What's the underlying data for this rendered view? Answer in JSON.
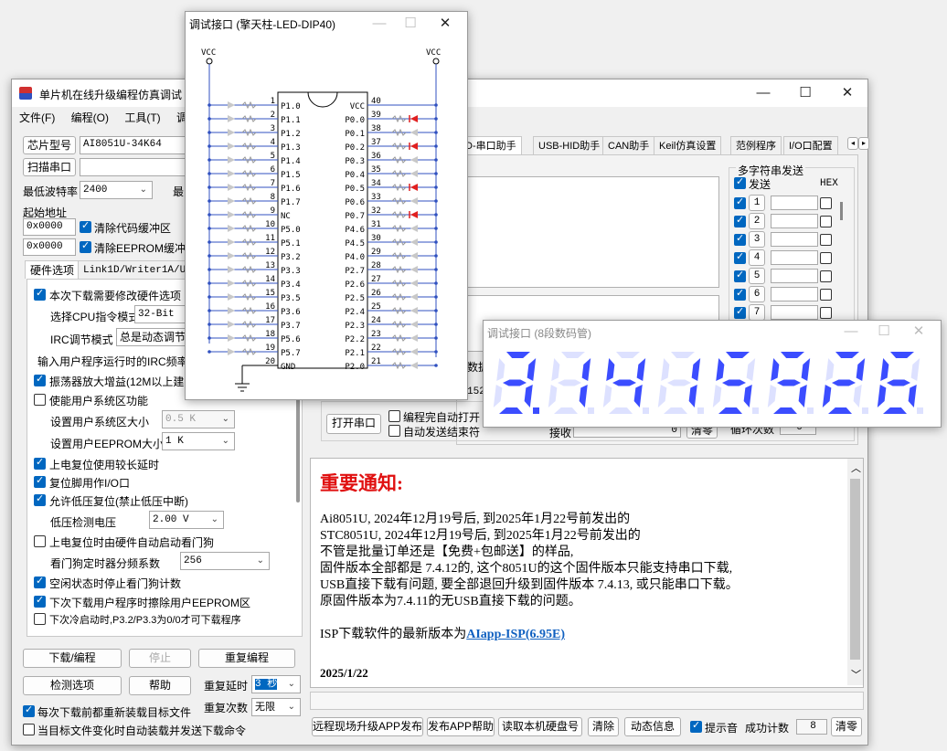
{
  "main": {
    "title": "单片机在线升级编程仿真调试",
    "menu": [
      "文件(F)",
      "编程(O)",
      "工具(T)",
      "调试"
    ],
    "chip_model_label": "芯片型号",
    "chip_model_value": "AI8051U-34K64",
    "scan_port_button": "扫描串口",
    "min_baud_label": "最低波特率",
    "min_baud_value": "2400",
    "max_baud_label": "最",
    "start_addr_label": "起始地址",
    "addr1": "0x0000",
    "clear_code_label": "清除代码缓冲区",
    "addr2": "0x0000",
    "clear_eeprom_label": "清除EEPROM缓冲区",
    "tabs": [
      "硬件选项",
      "Link1D/Writer1A/U8W"
    ],
    "options": {
      "modify_hw": "本次下载需要修改硬件选项",
      "cpu_mode_label": "选择CPU指令模式",
      "cpu_mode_value": "32-Bit",
      "irc_label": "IRC调节模式",
      "irc_value": "总是动态调节",
      "input_irc_label": "输入用户程序运行时的IRC频率",
      "osc_gain": "振荡器放大增益(12M以上建议",
      "user_sys_area": "使能用户系统区功能",
      "sys_area_size_label": "设置用户系统区大小",
      "sys_area_size_value": "0.5 K",
      "eeprom_size_label": "设置用户EEPROM大小",
      "eeprom_size_value": "1  K",
      "long_reset_delay": "上电复位使用较长延时",
      "reset_pin_io": "复位脚用作I/O口",
      "allow_lvr": "允许低压复位(禁止低压中断)",
      "lvd_label": "低压检测电压",
      "lvd_value": "2.00 V",
      "wdt_auto": "上电复位时由硬件自动启动看门狗",
      "wdt_div_label": "看门狗定时器分频系数",
      "wdt_div_value": "256",
      "idle_stop_wdt": "空闲状态时停止看门狗计数",
      "erase_eeprom": "下次下载用户程序时擦除用户EEPROM区",
      "cold_boot": "下次冷启动时,P3.2/P3.3为0/0才可下载程序"
    },
    "buttons": {
      "download": "下载/编程",
      "stop": "停止",
      "repeat": "重复编程",
      "check_options": "检测选项",
      "help": "帮助",
      "repeat_delay_label": "重复延时",
      "repeat_delay_value": "3 秒",
      "repeat_count_label": "重复次数",
      "repeat_count_value": "无限"
    },
    "reload_target": "每次下载前都重新装载目标文件",
    "auto_reload": "当目标文件变化时自动装载并发送下载命令",
    "right_tabs": [
      "D-串口助手",
      "USB-HID助手",
      "CAN助手",
      "Keil仿真设置",
      "范例程序",
      "I/O口配置"
    ],
    "multi_send": {
      "title": "多字符串发送",
      "send_label": "发送",
      "hex_label": "HEX",
      "rows": [
        "1",
        "2",
        "3",
        "4",
        "5",
        "6",
        "7"
      ]
    },
    "serial": {
      "data_label": "数据",
      "baud_partial": "152",
      "open_port": "打开串口",
      "auto_open": "编程完自动打开",
      "auto_send_end": "自动发送结束符",
      "recv_label": "接收",
      "recv_count": "0",
      "clear": "清零",
      "loop_label": "循环次数",
      "loop_count": "0"
    },
    "notice": {
      "heading": "重要通知:",
      "lines": [
        "Ai8051U,  2024年12月19号后, 到2025年1月22号前发出的",
        "STC8051U, 2024年12月19号后, 到2025年1月22号前发出的",
        "不管是批量订单还是【免费+包邮送】的样品,",
        "固件版本全部都是 7.4.12的, 这个8051U的这个固件版本只能支持串口下载,",
        "USB直接下载有问题, 要全部退回升级到固件版本 7.4.13, 或只能串口下载。",
        "原固件版本为7.4.11的无USB直接下载的问题。"
      ],
      "isp_prefix": "ISP下载软件的最新版本为",
      "isp_link": "AIapp-ISP(6.95E)",
      "date": "2025/1/22"
    },
    "bottom": {
      "b1": "远程现场升级APP发布",
      "b2": "发布APP帮助",
      "b3": "读取本机硬盘号",
      "b4": "清除",
      "b5": "动态信息",
      "prompt": "提示音",
      "success_label": "成功计数",
      "success_count": "8",
      "clear": "清零"
    }
  },
  "dip": {
    "title": "调试接口 (擎天柱-LED-DIP40)",
    "vcc": "VCC",
    "chip_vcc": "VCC",
    "left_pins": [
      {
        "n": "1",
        "name": "P1.0"
      },
      {
        "n": "2",
        "name": "P1.1"
      },
      {
        "n": "3",
        "name": "P1.2"
      },
      {
        "n": "4",
        "name": "P1.3"
      },
      {
        "n": "5",
        "name": "P1.4"
      },
      {
        "n": "6",
        "name": "P1.5"
      },
      {
        "n": "7",
        "name": "P1.6"
      },
      {
        "n": "8",
        "name": "P1.7"
      },
      {
        "n": "9",
        "name": "NC"
      },
      {
        "n": "10",
        "name": "P5.0"
      },
      {
        "n": "11",
        "name": "P5.1"
      },
      {
        "n": "12",
        "name": "P3.2"
      },
      {
        "n": "13",
        "name": "P3.3"
      },
      {
        "n": "14",
        "name": "P3.4"
      },
      {
        "n": "15",
        "name": "P3.5"
      },
      {
        "n": "16",
        "name": "P3.6"
      },
      {
        "n": "17",
        "name": "P3.7"
      },
      {
        "n": "18",
        "name": "P5.6"
      },
      {
        "n": "19",
        "name": "P5.7"
      },
      {
        "n": "20",
        "name": "GND"
      }
    ],
    "right_pins": [
      {
        "n": "40",
        "name": "VCC"
      },
      {
        "n": "39",
        "name": "P0.0"
      },
      {
        "n": "38",
        "name": "P0.1"
      },
      {
        "n": "37",
        "name": "P0.2"
      },
      {
        "n": "36",
        "name": "P0.3"
      },
      {
        "n": "35",
        "name": "P0.4"
      },
      {
        "n": "34",
        "name": "P0.5"
      },
      {
        "n": "33",
        "name": "P0.6"
      },
      {
        "n": "32",
        "name": "P0.7"
      },
      {
        "n": "31",
        "name": "P4.6"
      },
      {
        "n": "30",
        "name": "P4.5"
      },
      {
        "n": "29",
        "name": "P4.0"
      },
      {
        "n": "28",
        "name": "P2.7"
      },
      {
        "n": "27",
        "name": "P2.6"
      },
      {
        "n": "26",
        "name": "P2.5"
      },
      {
        "n": "25",
        "name": "P2.4"
      },
      {
        "n": "24",
        "name": "P2.3"
      },
      {
        "n": "23",
        "name": "P2.2"
      },
      {
        "n": "22",
        "name": "P2.1"
      },
      {
        "n": "21",
        "name": "P2.0"
      }
    ],
    "lit_leds": [
      "39",
      "37",
      "34",
      "32"
    ],
    "led_on_color": "#e02020",
    "led_off_color": "#c8c8c8"
  },
  "seg": {
    "title": "调试接口 (8段数码管)",
    "digits": [
      "3.",
      "1",
      "4",
      "1",
      "5",
      "9",
      "2",
      "6"
    ],
    "on_color": "#3b4dff",
    "off_color": "#dde1ff"
  }
}
